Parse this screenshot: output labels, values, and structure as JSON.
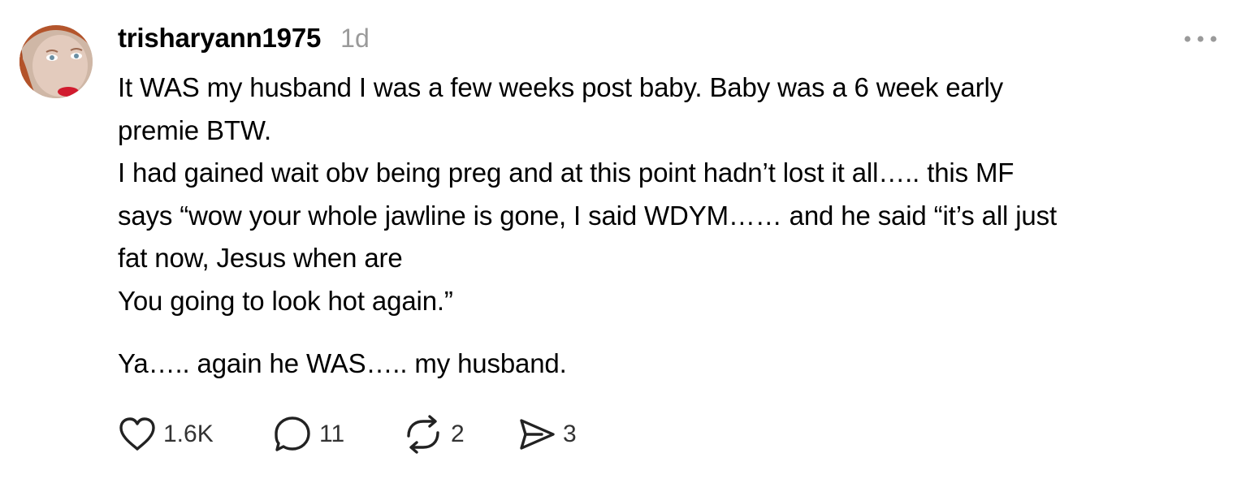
{
  "post": {
    "author": {
      "username": "trisharyann1975",
      "avatar_icon": "profile-photo"
    },
    "timestamp": "1d",
    "menu_icon": "ellipsis-icon",
    "body": {
      "lines": [
        "It WAS my husband I was a few weeks post baby. Baby was a 6 week early",
        "premie BTW.",
        "I had gained wait obv being preg and at this point hadn’t lost it all….. this MF",
        "says “wow your whole jawline is gone, I said WDYM…… and he said “it’s all just",
        "fat now, Jesus when are",
        "You going to look hot again.”",
        "Ya….. again he WAS….. my husband."
      ]
    },
    "actions": {
      "like": {
        "icon": "heart-icon",
        "count": "1.6K"
      },
      "reply": {
        "icon": "comment-bubble-icon",
        "count": "11"
      },
      "repost": {
        "icon": "repost-arrows-icon",
        "count": "2"
      },
      "share": {
        "icon": "paper-plane-icon",
        "count": "3"
      }
    },
    "colors": {
      "text": "#000000",
      "muted": "#9a9a9a",
      "icon": "#222222"
    }
  }
}
